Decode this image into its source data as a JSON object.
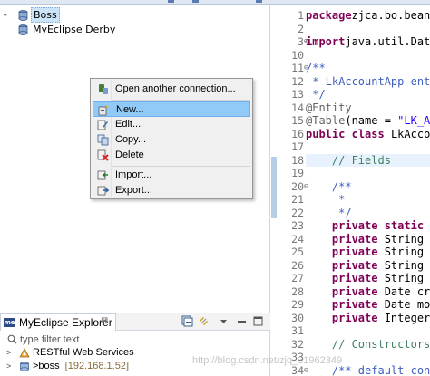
{
  "db_browser": {
    "tree": [
      {
        "label": "Boss",
        "expanded": true,
        "selected": true
      },
      {
        "label": "MyEclipse Derby",
        "expanded": false,
        "selected": false
      }
    ]
  },
  "context_menu": {
    "items": [
      {
        "label": "Open another connection...",
        "icon": "connect-icon"
      },
      {
        "label": "New...",
        "icon": "new-connection-icon",
        "highlighted": true
      },
      {
        "label": "Edit...",
        "icon": "edit-icon"
      },
      {
        "label": "Copy...",
        "icon": "copy-icon"
      },
      {
        "label": "Delete",
        "icon": "delete-icon"
      },
      {
        "label": "Import...",
        "icon": "import-icon"
      },
      {
        "label": "Export...",
        "icon": "export-icon"
      }
    ]
  },
  "explorer": {
    "tab_label": "MyEclipse Explorer",
    "tab_close": "⊠",
    "filter_placeholder": "type filter text",
    "rows": [
      {
        "twisty": ">",
        "label": "RESTful Web Services",
        "address": ""
      },
      {
        "twisty": ">",
        "label": ">boss",
        "address": "[192.168.1.52]"
      }
    ]
  },
  "editor": {
    "lines": [
      {
        "n": "1",
        "fold": "",
        "parts": [
          [
            "kw",
            "package"
          ],
          [
            "",
            "zjca.bo.beans"
          ]
        ]
      },
      {
        "n": "2",
        "fold": "",
        "parts": []
      },
      {
        "n": "3",
        "fold": "⊕",
        "parts": [
          [
            "kw",
            "import"
          ],
          [
            "",
            "java.util.Dat"
          ]
        ]
      },
      {
        "n": "10",
        "fold": "",
        "parts": []
      },
      {
        "n": "11",
        "fold": "⊖",
        "parts": [
          [
            "jd",
            "/**"
          ]
        ]
      },
      {
        "n": "12",
        "fold": "",
        "parts": [
          [
            "jd",
            " * LkAccountApp enti"
          ]
        ]
      },
      {
        "n": "13",
        "fold": "",
        "parts": [
          [
            "jd",
            " */"
          ]
        ]
      },
      {
        "n": "14",
        "fold": "",
        "parts": [
          [
            "an",
            "@Entity"
          ]
        ]
      },
      {
        "n": "15",
        "fold": "",
        "parts": [
          [
            "an",
            "@Table"
          ],
          [
            "",
            "(name = "
          ],
          [
            "st",
            "\"LK_AC"
          ]
        ]
      },
      {
        "n": "16",
        "fold": "",
        "parts": [
          [
            "kw",
            "public"
          ],
          [
            "",
            " "
          ],
          [
            "kw",
            "class"
          ],
          [
            "",
            " LkAccou"
          ]
        ]
      },
      {
        "n": "17",
        "fold": "",
        "parts": []
      },
      {
        "n": "18",
        "fold": "",
        "parts": [
          [
            "",
            "    "
          ],
          [
            "cm",
            "// Fields"
          ]
        ],
        "highlight": true
      },
      {
        "n": "19",
        "fold": "",
        "parts": []
      },
      {
        "n": "20",
        "fold": "⊖",
        "parts": [
          [
            "",
            "    "
          ],
          [
            "jd",
            "/**"
          ]
        ]
      },
      {
        "n": "21",
        "fold": "",
        "parts": [
          [
            "",
            "    "
          ],
          [
            "jd",
            " *"
          ]
        ]
      },
      {
        "n": "22",
        "fold": "",
        "parts": [
          [
            "",
            "    "
          ],
          [
            "jd",
            " */"
          ]
        ]
      },
      {
        "n": "23",
        "fold": "",
        "parts": [
          [
            "",
            "    "
          ],
          [
            "kw",
            "private"
          ],
          [
            "",
            " "
          ],
          [
            "kw",
            "static"
          ],
          [
            "",
            " f"
          ]
        ]
      },
      {
        "n": "24",
        "fold": "",
        "parts": [
          [
            "",
            "    "
          ],
          [
            "kw",
            "private"
          ],
          [
            "",
            " String i"
          ]
        ]
      },
      {
        "n": "25",
        "fold": "",
        "parts": [
          [
            "",
            "    "
          ],
          [
            "kw",
            "private"
          ],
          [
            "",
            " String a"
          ]
        ]
      },
      {
        "n": "26",
        "fold": "",
        "parts": [
          [
            "",
            "    "
          ],
          [
            "kw",
            "private"
          ],
          [
            "",
            " String a"
          ]
        ]
      },
      {
        "n": "27",
        "fold": "",
        "parts": [
          [
            "",
            "    "
          ],
          [
            "kw",
            "private"
          ],
          [
            "",
            " String r"
          ]
        ]
      },
      {
        "n": "28",
        "fold": "",
        "parts": [
          [
            "",
            "    "
          ],
          [
            "kw",
            "private"
          ],
          [
            "",
            " Date cre"
          ]
        ]
      },
      {
        "n": "29",
        "fold": "",
        "parts": [
          [
            "",
            "    "
          ],
          [
            "kw",
            "private"
          ],
          [
            "",
            " Date mod"
          ]
        ]
      },
      {
        "n": "30",
        "fold": "",
        "parts": [
          [
            "",
            "    "
          ],
          [
            "kw",
            "private"
          ],
          [
            "",
            " Integer"
          ]
        ]
      },
      {
        "n": "31",
        "fold": "",
        "parts": []
      },
      {
        "n": "32",
        "fold": "",
        "parts": [
          [
            "",
            "    "
          ],
          [
            "cm",
            "// Constructors"
          ]
        ]
      },
      {
        "n": "33",
        "fold": "",
        "parts": []
      },
      {
        "n": "34",
        "fold": "⊖",
        "parts": [
          [
            "",
            "    "
          ],
          [
            "jd",
            "/** default con"
          ]
        ]
      }
    ]
  },
  "watermark": "http://blog.csdn.net/zjq_31962349"
}
